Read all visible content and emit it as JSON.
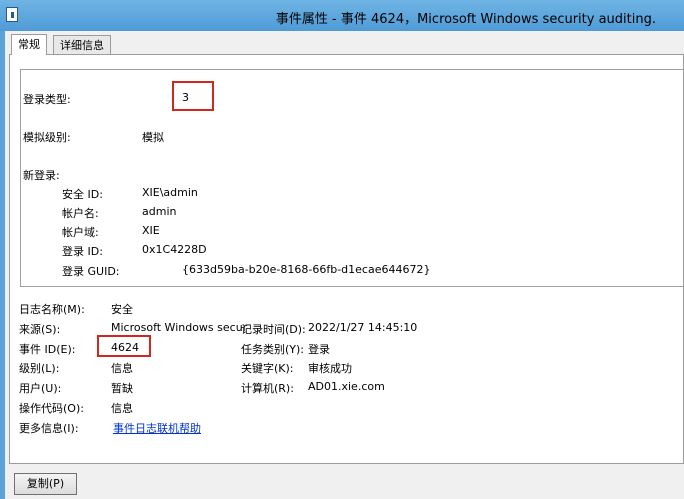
{
  "window": {
    "title": "事件属性 - 事件 4624，Microsoft Windows security auditing."
  },
  "tabs": [
    {
      "label": "常规",
      "active": true
    },
    {
      "label": "详细信息",
      "active": false
    }
  ],
  "description": {
    "logon_type_label": "登录类型:",
    "logon_type_value": "3",
    "impersonation_label": "模拟级别:",
    "impersonation_value": "模拟",
    "new_logon_label": "新登录:",
    "fields": [
      {
        "label": "安全 ID:",
        "value": "XIE\\admin"
      },
      {
        "label": "帐户名:",
        "value": "admin"
      },
      {
        "label": "帐户域:",
        "value": "XIE"
      },
      {
        "label": "登录 ID:",
        "value": "0x1C4228D"
      },
      {
        "label": "登录 GUID:",
        "value": "{633d59ba-b20e-8168-66fb-d1ecae644672}"
      }
    ]
  },
  "properties": {
    "log_name": {
      "label": "日志名称(M):",
      "value": "安全"
    },
    "source": {
      "label": "来源(S):",
      "value": "Microsoft Windows secur"
    },
    "logged": {
      "label": "记录时间(D):",
      "value": "2022/1/27 14:45:10"
    },
    "event_id": {
      "label": "事件 ID(E):",
      "value": "4624"
    },
    "task_category": {
      "label": "任务类别(Y):",
      "value": "登录"
    },
    "level": {
      "label": "级别(L):",
      "value": "信息"
    },
    "keywords": {
      "label": "关键字(K):",
      "value": "审核成功"
    },
    "user": {
      "label": "用户(U):",
      "value": "暂缺"
    },
    "computer": {
      "label": "计算机(R):",
      "value": "AD01.xie.com"
    },
    "opcode": {
      "label": "操作代码(O):",
      "value": "信息"
    },
    "more_info": {
      "label": "更多信息(I):",
      "link": "事件日志联机帮助"
    }
  },
  "buttons": {
    "copy": "复制(P)"
  },
  "colors": {
    "titlebar": "#5ba3d9",
    "highlight": "#d0281f",
    "link": "#0033cc"
  }
}
